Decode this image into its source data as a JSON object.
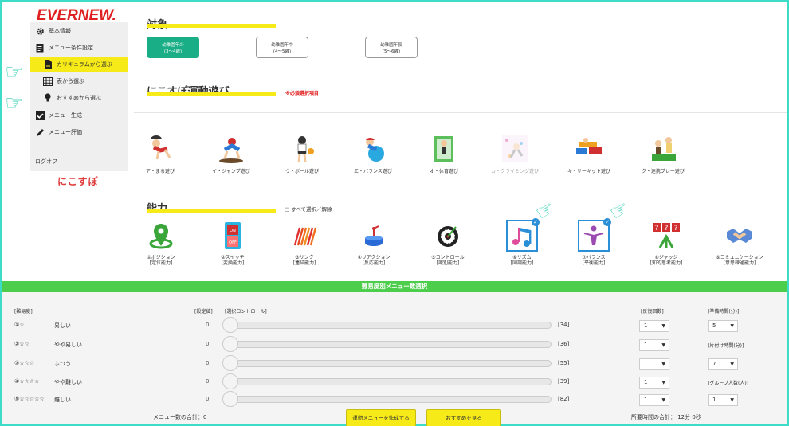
{
  "brand": {
    "logo": "EVERNEW.",
    "sublogo": "にこすぽ"
  },
  "sidebar": {
    "items": [
      {
        "label": "基本情報",
        "icon": "gear-icon"
      },
      {
        "label": "メニュー条件設定",
        "icon": "clipboard-icon"
      },
      {
        "label": "カリキュラムから選ぶ",
        "icon": "document-icon",
        "active": true
      },
      {
        "label": "表から選ぶ",
        "icon": "grid-icon"
      },
      {
        "label": "おすすめから選ぶ",
        "icon": "lightbulb-icon"
      },
      {
        "label": "メニュー生成",
        "icon": "checkbox-icon"
      },
      {
        "label": "メニュー評価",
        "icon": "pencil-icon"
      }
    ],
    "logout": "ログオフ"
  },
  "target": {
    "title": "対象",
    "options": [
      {
        "line1": "幼稚園年少",
        "line2": "(3〜4歳)",
        "selected": true
      },
      {
        "line1": "幼稚園年中",
        "line2": "(4〜5歳)",
        "selected": false
      },
      {
        "line1": "幼稚園年長",
        "line2": "(5〜6歳)",
        "selected": false
      }
    ]
  },
  "activities": {
    "title": "にこすぽ運動遊び",
    "required_note": "※必須選択項目",
    "items": [
      {
        "label": "ア・まる遊び"
      },
      {
        "label": "イ・ジャンプ遊び"
      },
      {
        "label": "ウ・ボール遊び"
      },
      {
        "label": "エ・バランス遊び"
      },
      {
        "label": "オ・体育遊び"
      },
      {
        "label": "カ・クライミング遊び"
      },
      {
        "label": "キ・サーキット遊び"
      },
      {
        "label": "ク・連携プレー遊び"
      }
    ]
  },
  "abilities": {
    "title": "能力",
    "select_all": "□ すべて選択／解除",
    "items": [
      {
        "line1": "①ポジション",
        "line2": "[定位能力]",
        "selected": false
      },
      {
        "line1": "②スイッチ",
        "line2": "[変換能力]",
        "selected": false
      },
      {
        "line1": "③リンク",
        "line2": "[連結能力]",
        "selected": false
      },
      {
        "line1": "④リアクション",
        "line2": "[反応能力]",
        "selected": false
      },
      {
        "line1": "⑤コントロール",
        "line2": "[識別能力]",
        "selected": false
      },
      {
        "line1": "⑥リズム",
        "line2": "[同調能力]",
        "selected": true
      },
      {
        "line1": "⑦バランス",
        "line2": "[平衡能力]",
        "selected": true
      },
      {
        "line1": "⑧ジャッジ",
        "line2": "[知的思考能力]",
        "selected": false
      },
      {
        "line1": "⑨コミュニケーション",
        "line2": "[意思疎通能力]",
        "selected": false
      }
    ]
  },
  "difficulty": {
    "bar_title": "難易度別メニュー数選択",
    "headers": {
      "level": "[難易度]",
      "setting": "[設定値]",
      "control": "[選択コントロール]",
      "repeat": "[反復回数]",
      "prep": "[準備時間(分)]"
    },
    "rows": [
      {
        "stars": "①☆",
        "name": "易しい",
        "value": "0",
        "max": "[34]",
        "repeat": "1"
      },
      {
        "stars": "②☆☆",
        "name": "やや易しい",
        "value": "0",
        "max": "[36]",
        "repeat": "1"
      },
      {
        "stars": "③☆☆☆",
        "name": "ふつう",
        "value": "0",
        "max": "[55]",
        "repeat": "1"
      },
      {
        "stars": "④☆☆☆☆",
        "name": "やや難しい",
        "value": "0",
        "max": "[39]",
        "repeat": "1"
      },
      {
        "stars": "⑤☆☆☆☆☆",
        "name": "難しい",
        "value": "0",
        "max": "[82]",
        "repeat": "1"
      }
    ],
    "prep_value": "5",
    "cleanup_label": "[片付け時間(分)]",
    "cleanup_value": "7",
    "group_label": "[グループ人数(人)]",
    "group_value": "1",
    "total_menus": "メニュー数の合計：0",
    "create_button": "運動メニューを作成する",
    "recommend_button": "おすすめを見る",
    "total_time": "所要時間の合計： 12分 0秒"
  }
}
